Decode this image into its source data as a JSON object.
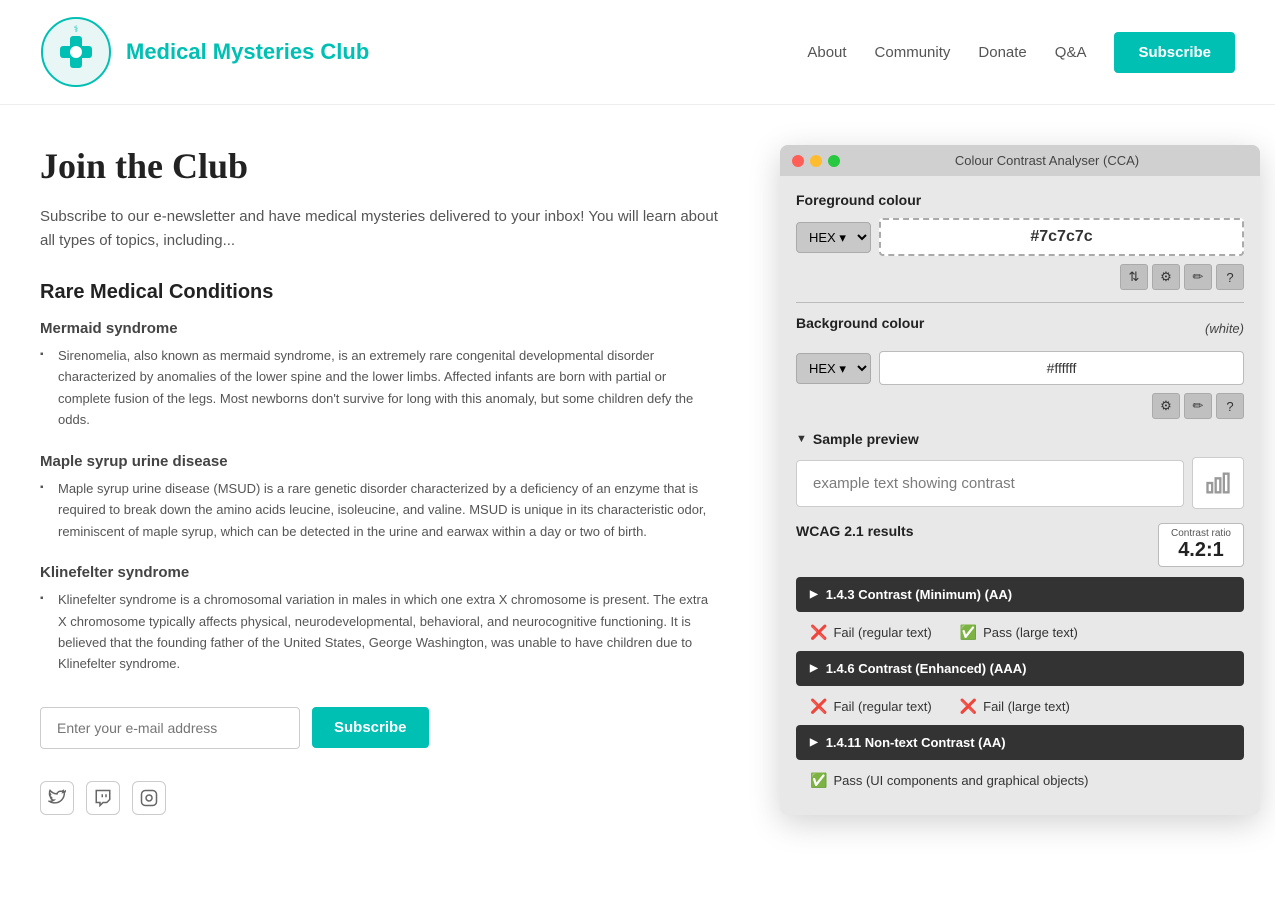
{
  "header": {
    "site_title": "Medical Mysteries Club",
    "nav": {
      "about": "About",
      "community": "Community",
      "donate": "Donate",
      "qa": "Q&A",
      "subscribe": "Subscribe"
    }
  },
  "main": {
    "page_title": "Join the Club",
    "page_desc": "Subscribe to our e-newsletter and have medical mysteries delivered to your inbox! You will learn about all types of topics, including...",
    "section_title": "Rare Medical Conditions",
    "conditions": [
      {
        "title": "Mermaid syndrome",
        "desc": "Sirenomelia, also known as mermaid syndrome, is an extremely rare congenital developmental disorder characterized by anomalies of the lower spine and the lower limbs. Affected infants are born with partial or complete fusion of the legs. Most newborns don't survive for long with this anomaly, but some children defy the odds."
      },
      {
        "title": "Maple syrup urine disease",
        "desc": "Maple syrup urine disease (MSUD) is a rare genetic disorder characterized by a deficiency of an enzyme that is required to break down the amino acids leucine, isoleucine, and valine. MSUD is unique in its characteristic odor, reminiscent of maple syrup, which can be detected in the urine and earwax within a day or two of birth."
      },
      {
        "title": "Klinefelter syndrome",
        "desc": "Klinefelter syndrome is a chromosomal variation in males in which one extra X chromosome is present. The extra X chromosome typically affects physical, neurodevelopmental, behavioral, and neurocognitive functioning. It is believed that the founding father of the United States, George Washington, was unable to have children due to Klinefelter syndrome."
      }
    ],
    "email_placeholder": "Enter your e-mail address",
    "subscribe_btn": "Subscribe"
  },
  "cca": {
    "title": "Colour Contrast Analyser (CCA)",
    "foreground_label": "Foreground colour",
    "fg_format": "HEX",
    "fg_value": "#7c7c7c",
    "bg_label": "Background colour",
    "bg_white": "(white)",
    "bg_format": "HEX",
    "bg_value": "#ffffff",
    "sample_preview_label": "Sample preview",
    "sample_text": "example text showing contrast",
    "wcag_label": "WCAG 2.1 results",
    "contrast_ratio_label": "Contrast ratio",
    "contrast_ratio_value": "4.2:1",
    "wcag_items": [
      {
        "id": "1443",
        "label": "1.4.3 Contrast (Minimum) (AA)",
        "results": [
          {
            "pass": false,
            "text": "Fail (regular text)"
          },
          {
            "pass": true,
            "text": "Pass (large text)"
          }
        ]
      },
      {
        "id": "1446",
        "label": "1.4.6 Contrast (Enhanced) (AAA)",
        "results": [
          {
            "pass": false,
            "text": "Fail (regular text)"
          },
          {
            "pass": false,
            "text": "Fail (large text)"
          }
        ]
      },
      {
        "id": "14411",
        "label": "1.4.11 Non-text Contrast (AA)",
        "results": [
          {
            "pass": true,
            "text": "Pass (UI components and graphical objects)"
          }
        ]
      }
    ]
  }
}
